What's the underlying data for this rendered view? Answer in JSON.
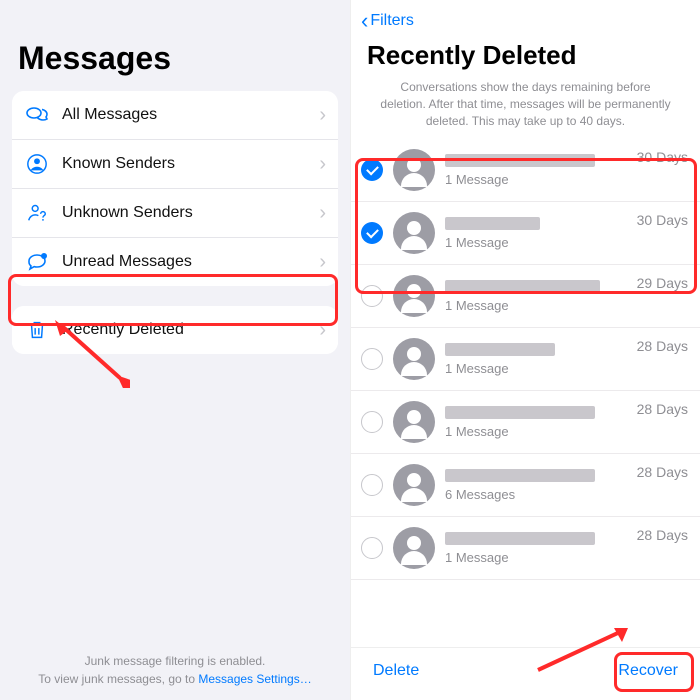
{
  "left": {
    "title": "Messages",
    "filters": [
      {
        "label": "All Messages"
      },
      {
        "label": "Known Senders"
      },
      {
        "label": "Unknown Senders"
      },
      {
        "label": "Unread Messages"
      }
    ],
    "recently_deleted": {
      "label": "Recently Deleted"
    },
    "footer_line1": "Junk message filtering is enabled.",
    "footer_line2a": "To view junk messages, go to ",
    "footer_link": "Messages Settings…"
  },
  "right": {
    "nav_back": "Filters",
    "title": "Recently Deleted",
    "note": "Conversations show the days remaining before deletion. After that time, messages will be permanently deleted. This may take up to 40 days.",
    "conversations": [
      {
        "selected": true,
        "name_w": 150,
        "sub": "1 Message",
        "days": "30 Days"
      },
      {
        "selected": true,
        "name_w": 95,
        "sub": "1 Message",
        "days": "30 Days"
      },
      {
        "selected": false,
        "name_w": 155,
        "sub": "1 Message",
        "days": "29 Days"
      },
      {
        "selected": false,
        "name_w": 110,
        "sub": "1 Message",
        "days": "28 Days"
      },
      {
        "selected": false,
        "name_w": 150,
        "sub": "1 Message",
        "days": "28 Days"
      },
      {
        "selected": false,
        "name_w": 150,
        "sub": "6 Messages",
        "days": "28 Days"
      },
      {
        "selected": false,
        "name_w": 150,
        "sub": "1 Message",
        "days": "28 Days"
      }
    ],
    "toolbar": {
      "delete": "Delete",
      "recover": "Recover"
    }
  }
}
